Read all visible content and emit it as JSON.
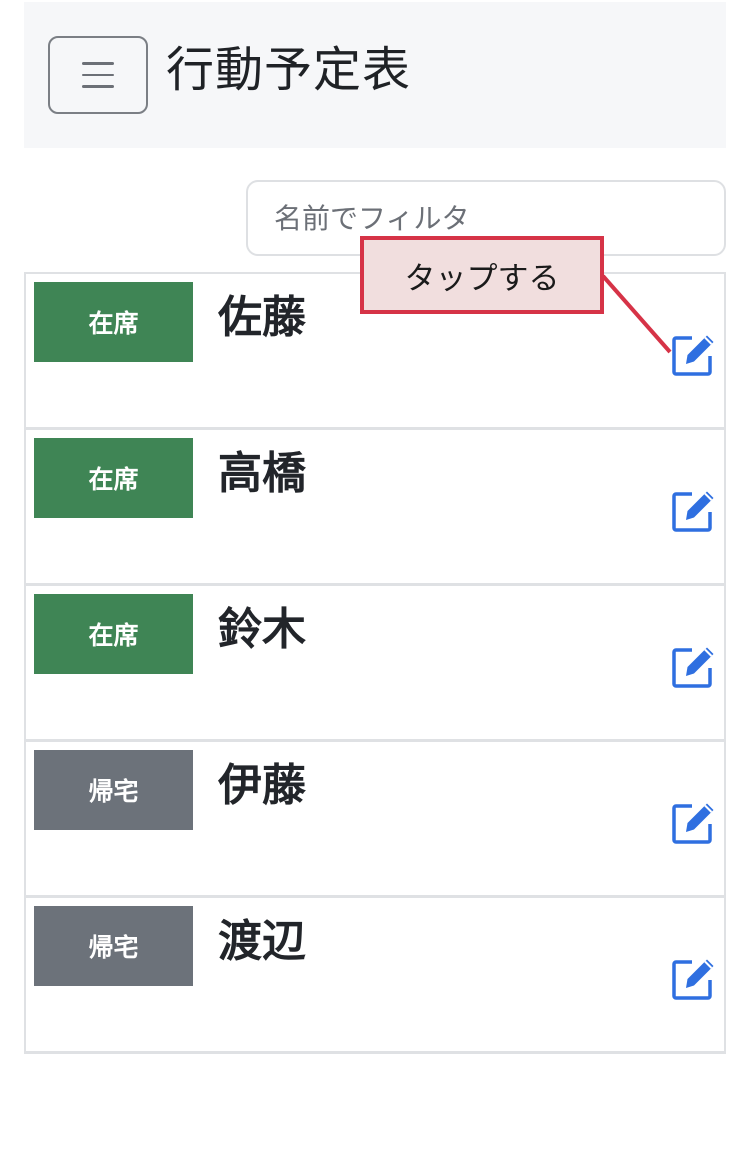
{
  "header": {
    "title": "行動予定表",
    "menu_icon": "hamburger-menu-icon"
  },
  "filter": {
    "placeholder": "名前でフィルタ",
    "value": ""
  },
  "annotation": {
    "text": "タップする",
    "color": "#d63347",
    "background": "#f1dede"
  },
  "colors": {
    "present": "#3f8555",
    "home": "#6c727a",
    "edit_icon": "#2f6fe0"
  },
  "members": [
    {
      "status": "在席",
      "status_type": "present",
      "name": "佐藤",
      "edit_icon": "edit-icon"
    },
    {
      "status": "在席",
      "status_type": "present",
      "name": "高橋",
      "edit_icon": "edit-icon"
    },
    {
      "status": "在席",
      "status_type": "present",
      "name": "鈴木",
      "edit_icon": "edit-icon"
    },
    {
      "status": "帰宅",
      "status_type": "home",
      "name": "伊藤",
      "edit_icon": "edit-icon"
    },
    {
      "status": "帰宅",
      "status_type": "home",
      "name": "渡辺",
      "edit_icon": "edit-icon"
    }
  ]
}
